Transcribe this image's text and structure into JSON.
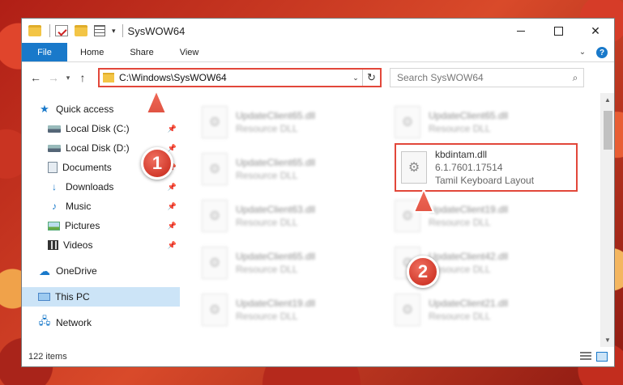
{
  "window": {
    "title": "SysWOW64"
  },
  "ribbon": {
    "tabs": [
      "File",
      "Home",
      "Share",
      "View"
    ]
  },
  "address": {
    "path": "C:\\Windows\\SysWOW64",
    "search_placeholder": "Search SysWOW64"
  },
  "sidebar": {
    "quick_access": "Quick access",
    "items": [
      "Local Disk (C:)",
      "Local Disk (D:)",
      "Documents",
      "Downloads",
      "Music",
      "Pictures",
      "Videos"
    ],
    "onedrive": "OneDrive",
    "this_pc": "This PC",
    "network": "Network"
  },
  "files": {
    "left": [
      {
        "name": "UpdateClient65.dll",
        "type": "Resource DLL"
      },
      {
        "name": "UpdateClient65.dll",
        "type": "Resource DLL"
      },
      {
        "name": "UpdateClient63.dll",
        "type": "Resource DLL"
      },
      {
        "name": "UpdateClient65.dll",
        "type": "Resource DLL"
      },
      {
        "name": "UpdateClient19.dll",
        "type": "Resource DLL"
      }
    ],
    "right": [
      {
        "name": "UpdateClient65.dll",
        "type": "Resource DLL"
      },
      {
        "name": "UpdateClient19.dll",
        "type": "Resource DLL"
      },
      {
        "name": "UpdateClient42.dll",
        "type": "Resource DLL"
      },
      {
        "name": "UpdateClient21.dll",
        "type": "Resource DLL"
      }
    ],
    "highlighted": {
      "name": "kbdintam.dll",
      "version": "6.1.7601.17514",
      "description": "Tamil Keyboard Layout"
    }
  },
  "status": {
    "item_count": "122 items"
  },
  "annotations": {
    "step1": "1",
    "step2": "2"
  },
  "colors": {
    "accent": "#1979ca",
    "annotation": "#e2473a"
  }
}
